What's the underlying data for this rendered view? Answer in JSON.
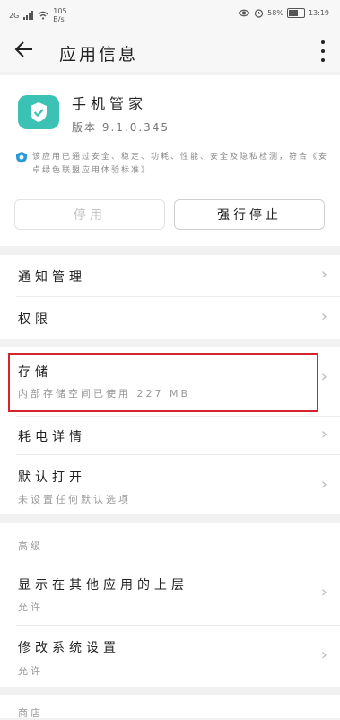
{
  "status_bar": {
    "network": "2G",
    "speed_value": "105",
    "speed_unit": "B/s",
    "battery": "58%",
    "time": "13:19"
  },
  "header": {
    "title": "应用信息"
  },
  "app": {
    "name": "手机管家",
    "version": "版本 9.1.0.345"
  },
  "notice": "该应用已通过安全、稳定、功耗、性能、安全及隐私检测，符合《安卓绿色联盟应用体验标准》",
  "buttons": {
    "disable": "停用",
    "force_stop": "强行停止"
  },
  "settings": {
    "notification": "通知管理",
    "permissions": "权限",
    "storage": {
      "title": "存储",
      "subtitle": "内部存储空间已使用 227 MB"
    },
    "battery": "耗电详情",
    "default_open": {
      "title": "默认打开",
      "subtitle": "未设置任何默认选项"
    }
  },
  "advanced": {
    "section_label": "高级",
    "overlay": {
      "title": "显示在其他应用的上层",
      "subtitle": "允许"
    },
    "modify_system": {
      "title": "修改系统设置",
      "subtitle": "允许"
    }
  },
  "store": {
    "section_label": "商店"
  },
  "colors": {
    "app_icon": "#3bc2b4",
    "highlight": "#d3252b"
  }
}
